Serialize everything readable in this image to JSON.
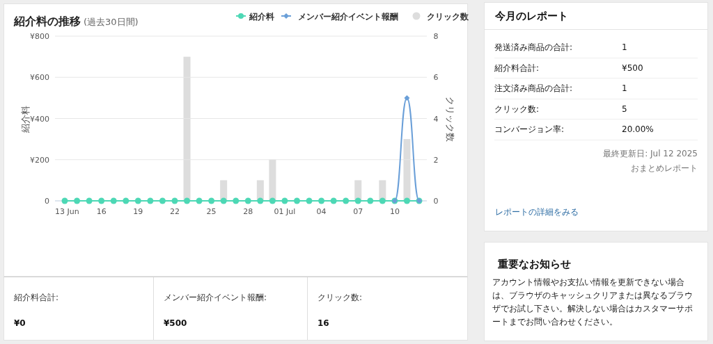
{
  "trend_card": {
    "title": "紹介料の推移",
    "subtitle": "(過去30日間)",
    "charts": [
      {
        "chart_data": {
          "type": "line",
          "ylabel": "紹介料",
          "grid": true,
          "legend": "top-right",
          "categories": [
            "13 Jun",
            null,
            null,
            "16",
            null,
            null,
            "19",
            null,
            null,
            "22",
            null,
            null,
            "25",
            null,
            null,
            "28",
            null,
            null,
            "01 Jul",
            null,
            null,
            "04",
            null,
            null,
            "07",
            null,
            null,
            "10",
            null,
            null
          ],
          "ylim": [
            0,
            800
          ],
          "yticks": [
            {
              "value": 0,
              "label": "0"
            },
            {
              "value": 200,
              "label": "¥200"
            },
            {
              "value": 400,
              "label": "¥400"
            },
            {
              "value": 600,
              "label": "¥600"
            },
            {
              "value": 800,
              "label": "¥800"
            }
          ],
          "series": [
            {
              "name": "紹介料",
              "color": "#4dd8b5",
              "marker": "circle",
              "values": [
                0,
                0,
                0,
                0,
                0,
                0,
                0,
                0,
                0,
                0,
                0,
                0,
                0,
                0,
                0,
                0,
                0,
                0,
                0,
                0,
                0,
                0,
                0,
                0,
                0,
                0,
                0,
                0,
                0,
                0
              ]
            },
            {
              "name": "メンバー紹介イベント報酬",
              "color": "#6a9fd8",
              "marker": "diamond",
              "values": [
                null,
                null,
                null,
                null,
                null,
                null,
                null,
                null,
                null,
                null,
                null,
                null,
                null,
                null,
                null,
                null,
                null,
                null,
                null,
                null,
                null,
                null,
                null,
                null,
                null,
                null,
                null,
                0,
                500,
                0
              ]
            }
          ]
        }
      },
      {
        "chart_data": {
          "type": "bar",
          "ylabel": "クリック数",
          "legend": "top-right",
          "categories": [
            null,
            null,
            null,
            null,
            null,
            null,
            null,
            null,
            null,
            null,
            null,
            null,
            null,
            null,
            null,
            null,
            null,
            null,
            null,
            null,
            null,
            null,
            null,
            null,
            null,
            null,
            null,
            null,
            null,
            null
          ],
          "ylim": [
            0,
            8
          ],
          "yticks": [
            {
              "value": 0,
              "label": "0"
            },
            {
              "value": 2,
              "label": "2"
            },
            {
              "value": 4,
              "label": "4"
            },
            {
              "value": 6,
              "label": "6"
            },
            {
              "value": 8,
              "label": "8"
            }
          ],
          "series": [
            {
              "name": "クリック数",
              "color": "#dddddd",
              "values": [
                0,
                0,
                0,
                0,
                0,
                0,
                0,
                0,
                0,
                0,
                7,
                0,
                0,
                1,
                0,
                0,
                1,
                2,
                0,
                0,
                0,
                0,
                0,
                0,
                1,
                0,
                1,
                0,
                3,
                0
              ]
            }
          ]
        }
      }
    ]
  },
  "summary_stats": [
    {
      "label": "紹介料合計:",
      "value": "¥0"
    },
    {
      "label": "メンバー紹介イベント報酬:",
      "value": "¥500"
    },
    {
      "label": "クリック数:",
      "value": "16"
    }
  ],
  "report_card": {
    "title": "今月のレポート",
    "rows": [
      {
        "label": "発送済み商品の合計:",
        "value": "1"
      },
      {
        "label": "紹介料合計:",
        "value": "¥500"
      },
      {
        "label": "注文済み商品の合計:",
        "value": "1"
      },
      {
        "label": "クリック数:",
        "value": "5"
      },
      {
        "label": "コンバージョン率:",
        "value": "20.00%"
      }
    ],
    "updated": "最終更新日: Jul 12 2025",
    "summary_link": "おまとめレポート",
    "details_link": "レポートの詳細をみる"
  },
  "notice_card": {
    "title": "重要なお知らせ",
    "body": "アカウント情報やお支払い情報を更新できない場合は、ブラウザのキャッシュクリアまたは異なるブラウザでお試し下さい。解決しない場合はカスタマーサポートまでお問い合わせください。"
  }
}
